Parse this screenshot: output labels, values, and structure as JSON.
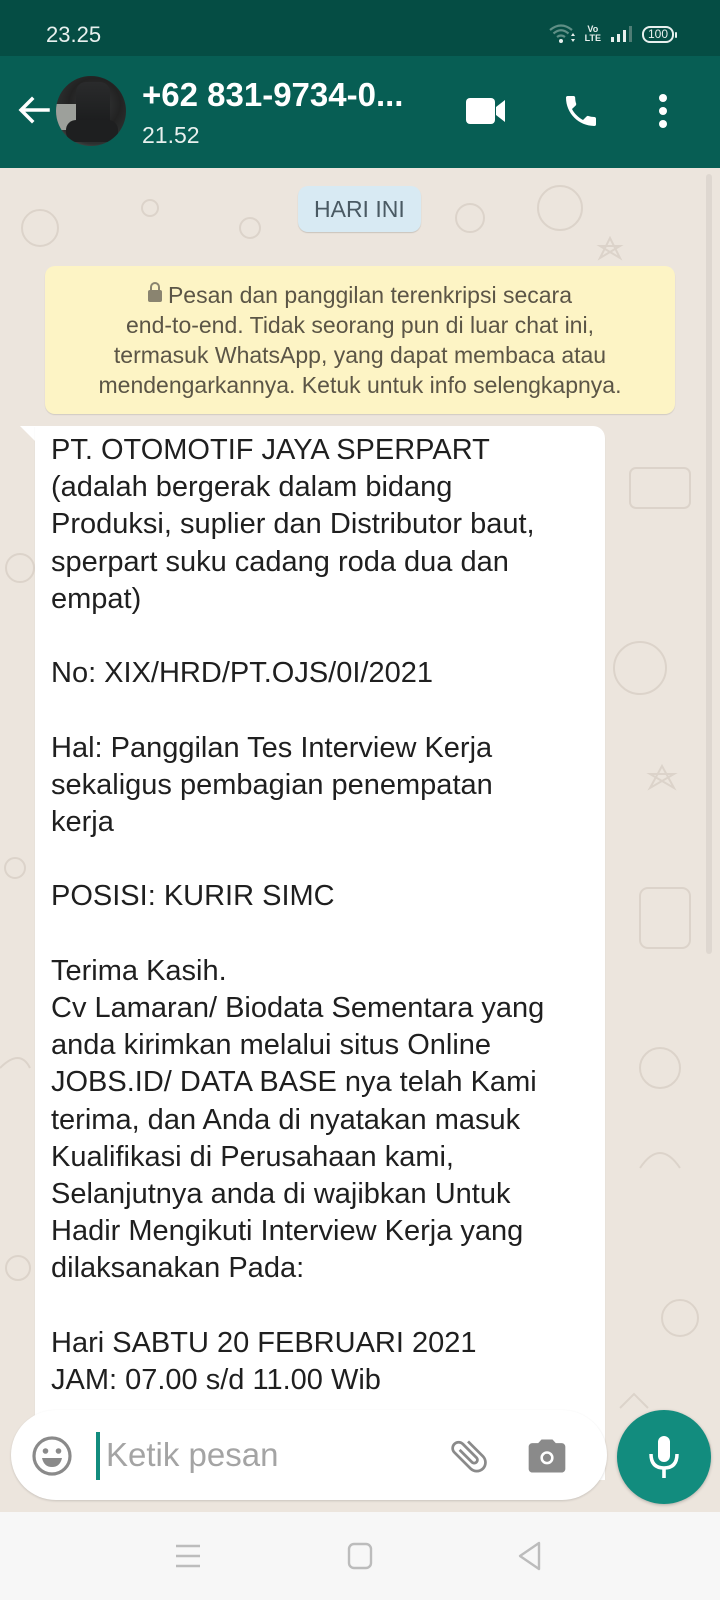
{
  "status_bar": {
    "time": "23.25",
    "network_label_top": "Vo",
    "network_label_bottom": "LTE",
    "battery": "100",
    "icons": [
      "wifi-icon",
      "volte-icon",
      "signal-icon",
      "battery-icon"
    ]
  },
  "app_bar": {
    "contact_name": "+62 831-9734-0...",
    "last_seen": "21.52",
    "icons": [
      "back-arrow-icon",
      "video-call-icon",
      "voice-call-icon",
      "more-options-icon"
    ]
  },
  "chat": {
    "date_chip": "HARI INI",
    "encryption_notice": "Pesan dan panggilan terenkripsi secara end-to-end. Tidak seorang pun di luar chat ini, termasuk WhatsApp, yang dapat membaca atau mendengarkannya. Ketuk untuk info selengkapnya.",
    "encryption_lines": [
      "Pesan dan panggilan terenkripsi secara",
      "end-to-end. Tidak seorang pun di luar chat ini,",
      "termasuk WhatsApp, yang dapat membaca atau",
      "mendengarkannya. Ketuk untuk info selengkapnya."
    ],
    "message": {
      "direction": "incoming",
      "lines": [
        "PT. OTOMOTIF JAYA SPERPART",
        "(adalah bergerak dalam bidang",
        "Produksi, suplier dan Distributor baut,",
        "sperpart suku cadang roda dua dan",
        "empat)",
        "",
        "No: XIX/HRD/PT.OJS/0I/2021",
        "",
        "Hal: Panggilan Tes Interview Kerja",
        "sekaligus pembagian penempatan",
        "kerja",
        "",
        "POSISI: KURIR SIMC",
        "",
        "Terima Kasih.",
        "Cv Lamaran/ Biodata Sementara yang",
        "anda kirimkan melalui situs Online",
        "JOBS.ID/ DATA BASE nya telah Kami",
        "terima, dan Anda di nyatakan masuk",
        "Kualifikasi di Perusahaan kami,",
        "Selanjutnya anda di wajibkan Untuk",
        "Hadir Mengikuti Interview Kerja yang",
        "dilaksanakan Pada:",
        "",
        "Hari SABTU 20 FEBRUARI 2021",
        "JAM: 07.00 s/d 11.00 Wib"
      ]
    }
  },
  "composer": {
    "placeholder": "Ketik pesan",
    "value": "",
    "icons": [
      "emoji-icon",
      "attach-icon",
      "camera-icon",
      "mic-icon"
    ]
  },
  "nav_bar": {
    "buttons": [
      "recents-menu",
      "home",
      "back"
    ]
  },
  "colors": {
    "status_bar": "#054d44",
    "app_bar": "#075e54",
    "accent": "#128c7e",
    "chat_bg": "#ece5dd",
    "date_chip_bg": "#d8eaf3",
    "notice_bg": "#fdf4c5",
    "bubble_bg": "#ffffff"
  }
}
